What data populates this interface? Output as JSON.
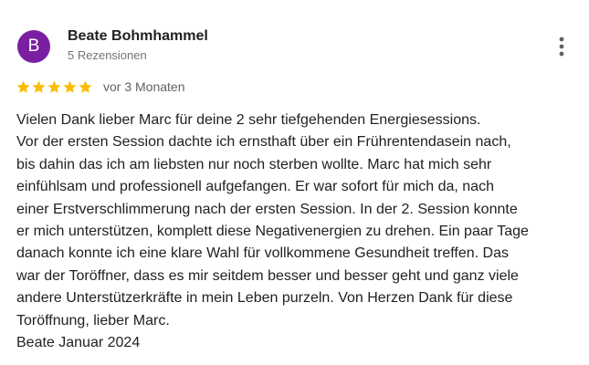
{
  "reviewer": {
    "initial": "B",
    "name": "Beate Bohmhammel",
    "meta": "5 Rezensionen",
    "avatar_color": "#7b1fa2"
  },
  "rating": {
    "stars": 5,
    "max_stars": 5,
    "star_color": "#fbbc04",
    "relative_date": "vor 3 Monaten"
  },
  "menu_icon": "more-vert-icon",
  "review": {
    "lines": [
      "Vielen Dank lieber Marc für deine 2 sehr tiefgehenden Energiesessions.",
      "Vor der ersten Session dachte ich ernsthaft über ein Frührentendasein nach,",
      "bis dahin das ich am liebsten nur noch sterben wollte. Marc hat mich sehr",
      "einfühlsam und professionell aufgefangen. Er war sofort für mich da, nach",
      "einer Erstverschlimmerung nach der ersten Session. In der 2. Session konnte",
      "er mich unterstützen, komplett diese Negativenergien zu drehen. Ein paar Tage",
      "danach konnte ich eine klare Wahl für vollkommene Gesundheit treffen. Das",
      "war der Toröffner, dass es mir seitdem besser und besser geht und ganz viele",
      "andere Unterstützerkräfte in mein Leben purzeln. Von Herzen Dank für diese",
      "Toröffnung, lieber Marc.",
      "Beate Januar 2024"
    ]
  }
}
